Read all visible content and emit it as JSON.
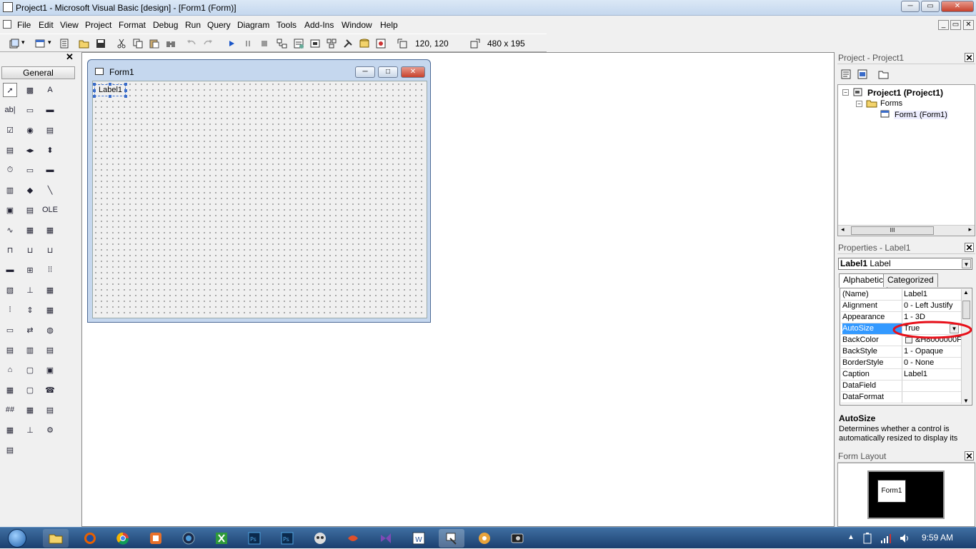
{
  "window": {
    "title": "Project1 - Microsoft Visual Basic [design] - [Form1 (Form)]",
    "controls": {
      "minimize": "─",
      "restore": "▭",
      "close": "✕"
    }
  },
  "menubar": {
    "items": [
      "File",
      "Edit",
      "View",
      "Project",
      "Format",
      "Debug",
      "Run",
      "Query",
      "Diagram",
      "Tools",
      "Add-Ins",
      "Window",
      "Help"
    ],
    "mdi_controls": {
      "minimize": "_",
      "restore": "▭",
      "close": "✕"
    }
  },
  "toolbar": {
    "position_readout": "120, 120",
    "size_readout": "480 x 195"
  },
  "toolbox": {
    "close": "✕",
    "tab_label": "General",
    "tools": [
      {
        "name": "pointer-tool",
        "glyph": "➚"
      },
      {
        "name": "picturebox-tool",
        "glyph": "▩"
      },
      {
        "name": "label-tool",
        "glyph": "A"
      },
      {
        "name": "textbox-tool",
        "glyph": "ab|"
      },
      {
        "name": "frame-tool",
        "glyph": "▭"
      },
      {
        "name": "commandbutton-tool",
        "glyph": "▬"
      },
      {
        "name": "checkbox-tool",
        "glyph": "☑"
      },
      {
        "name": "optionbutton-tool",
        "glyph": "◉"
      },
      {
        "name": "combobox-tool",
        "glyph": "▤"
      },
      {
        "name": "listbox-tool",
        "glyph": "▤"
      },
      {
        "name": "hscrollbar-tool",
        "glyph": "◂▸"
      },
      {
        "name": "vscrollbar-tool",
        "glyph": "⬍"
      },
      {
        "name": "timer-tool",
        "glyph": "⏱"
      },
      {
        "name": "drivelistbox-tool",
        "glyph": "▭"
      },
      {
        "name": "dirlistbox-tool",
        "glyph": "▬"
      },
      {
        "name": "filelistbox-tool",
        "glyph": "▥"
      },
      {
        "name": "shape-tool",
        "glyph": "◆"
      },
      {
        "name": "line-tool",
        "glyph": "╲"
      },
      {
        "name": "image-tool",
        "glyph": "▣"
      },
      {
        "name": "data-tool",
        "glyph": "▤"
      },
      {
        "name": "ole-tool",
        "glyph": "OLE"
      },
      {
        "name": "chart-tool",
        "glyph": "∿"
      },
      {
        "name": "grid-tool",
        "glyph": "▦"
      },
      {
        "name": "calendar-tool",
        "glyph": "▦"
      },
      {
        "name": "tab-tool",
        "glyph": "⊓"
      },
      {
        "name": "toolbar-tool",
        "glyph": "⊔"
      },
      {
        "name": "statusbar-tool",
        "glyph": "⊔"
      },
      {
        "name": "progressbar-tool",
        "glyph": "▬"
      },
      {
        "name": "treeview-tool",
        "glyph": "⊞"
      },
      {
        "name": "listview-tool",
        "glyph": "⁞⁞"
      },
      {
        "name": "imagelist-tool",
        "glyph": "▧"
      },
      {
        "name": "slider-tool",
        "glyph": "⊥"
      },
      {
        "name": "flexgrid-tool",
        "glyph": "▦"
      },
      {
        "name": "animation-tool",
        "glyph": "⁞"
      },
      {
        "name": "updown-tool",
        "glyph": "⇕"
      },
      {
        "name": "hierflexgrid-tool",
        "glyph": "▦"
      },
      {
        "name": "commondialog-tool",
        "glyph": "▭"
      },
      {
        "name": "winsock-tool",
        "glyph": "⇄"
      },
      {
        "name": "internet-tool",
        "glyph": "◍"
      },
      {
        "name": "richtext-tool",
        "glyph": "▤"
      },
      {
        "name": "mschart-tool",
        "glyph": "▥"
      },
      {
        "name": "datacombo-tool",
        "glyph": "▤"
      },
      {
        "name": "dataenv-tool",
        "glyph": "⌂"
      },
      {
        "name": "datarepeater-tool",
        "glyph": "▢"
      },
      {
        "name": "mediaplayer-tool",
        "glyph": "▣"
      },
      {
        "name": "coolbar-tool",
        "glyph": "▦"
      },
      {
        "name": "monitor-tool",
        "glyph": "▢"
      },
      {
        "name": "phone-tool",
        "glyph": "☎"
      },
      {
        "name": "maskedit-tool",
        "glyph": "##"
      },
      {
        "name": "datagrid-tool",
        "glyph": "▦"
      },
      {
        "name": "datalist-tool",
        "glyph": "▤"
      },
      {
        "name": "mscomm-tool",
        "glyph": "▦"
      },
      {
        "name": "coolbar2-tool",
        "glyph": "⊥"
      },
      {
        "name": "mapi-tool",
        "glyph": "⚙"
      },
      {
        "name": "sysinfo-tool",
        "glyph": "▤"
      }
    ]
  },
  "form": {
    "title": "Form1",
    "label_caption": "Label1",
    "buttons": {
      "minimize": "─",
      "maximize": "□",
      "close": "✕"
    }
  },
  "project_panel": {
    "title": "Project - Project1",
    "tree": {
      "root": "Project1 (Project1)",
      "folder": "Forms",
      "item": "Form1 (Form1)"
    },
    "scroll_thumb": "III"
  },
  "properties_panel": {
    "title": "Properties - Label1",
    "object_name": "Label1",
    "object_type": "Label",
    "tabs": [
      "Alphabetic",
      "Categorized"
    ],
    "rows": [
      {
        "name": "(Name)",
        "value": "Label1"
      },
      {
        "name": "Alignment",
        "value": "0 - Left Justify"
      },
      {
        "name": "Appearance",
        "value": "1 - 3D"
      },
      {
        "name": "AutoSize",
        "value": "True"
      },
      {
        "name": "BackColor",
        "value": "&H8000000F"
      },
      {
        "name": "BackStyle",
        "value": "1 - Opaque"
      },
      {
        "name": "BorderStyle",
        "value": "0 - None"
      },
      {
        "name": "Caption",
        "value": "Label1"
      },
      {
        "name": "DataField",
        "value": ""
      },
      {
        "name": "DataFormat",
        "value": ""
      }
    ],
    "selected_row": "AutoSize",
    "description_title": "AutoSize",
    "description_text": "Determines whether a control is automatically resized to display its",
    "highlight_color": "#e8101a"
  },
  "layout_panel": {
    "title": "Form Layout",
    "form_label": "Form1"
  },
  "taskbar": {
    "clock": "9:59 AM",
    "items": [
      "explorer",
      "firefox",
      "chrome",
      "app3",
      "app4",
      "excel",
      "photoshop",
      "photoshop2",
      "app7",
      "app8",
      "visualstudio",
      "word",
      "vb6",
      "app11",
      "app12"
    ]
  },
  "colors": {
    "accent_selection": "#3399ff",
    "taskbar": "#1b3f6f",
    "form_title_bg": "#c5d7ee"
  }
}
